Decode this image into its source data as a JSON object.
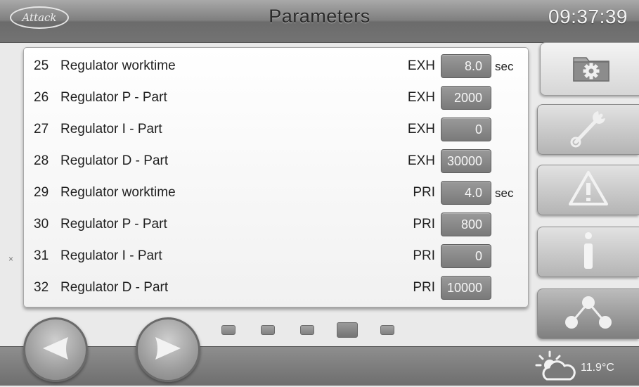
{
  "header": {
    "logo": "Attack",
    "title": "Parameters",
    "time": "09:37:39"
  },
  "parameters": [
    {
      "number": "25",
      "label": "Regulator worktime",
      "circuit": "EXH",
      "value": "8.0",
      "unit": "sec"
    },
    {
      "number": "26",
      "label": "Regulator P - Part",
      "circuit": "EXH",
      "value": "2000",
      "unit": ""
    },
    {
      "number": "27",
      "label": "Regulator I - Part",
      "circuit": "EXH",
      "value": "0",
      "unit": ""
    },
    {
      "number": "28",
      "label": "Regulator D - Part",
      "circuit": "EXH",
      "value": "30000",
      "unit": ""
    },
    {
      "number": "29",
      "label": "Regulator worktime",
      "circuit": "PRI",
      "value": "4.0",
      "unit": "sec"
    },
    {
      "number": "30",
      "label": "Regulator P - Part",
      "circuit": "PRI",
      "value": "800",
      "unit": ""
    },
    {
      "number": "31",
      "label": "Regulator I - Part",
      "circuit": "PRI",
      "value": "0",
      "unit": ""
    },
    {
      "number": "32",
      "label": "Regulator D - Part",
      "circuit": "PRI",
      "value": "10000",
      "unit": ""
    }
  ],
  "side_mark": "×",
  "side_buttons": [
    {
      "icon": "folder-gear-icon",
      "active": true
    },
    {
      "icon": "wrench-icon",
      "active": false
    },
    {
      "icon": "warning-icon",
      "active": false
    },
    {
      "icon": "info-icon",
      "active": false
    },
    {
      "icon": "network-icon",
      "active": false
    }
  ],
  "pagination": {
    "pages": 5,
    "current": 4
  },
  "footer": {
    "weather_icon": "sun-cloud-icon",
    "temperature": "11.9°C"
  },
  "colors": {
    "value_box": "#8a8a8a",
    "header": "#7f7f7f",
    "text": "#1f1f1f"
  }
}
